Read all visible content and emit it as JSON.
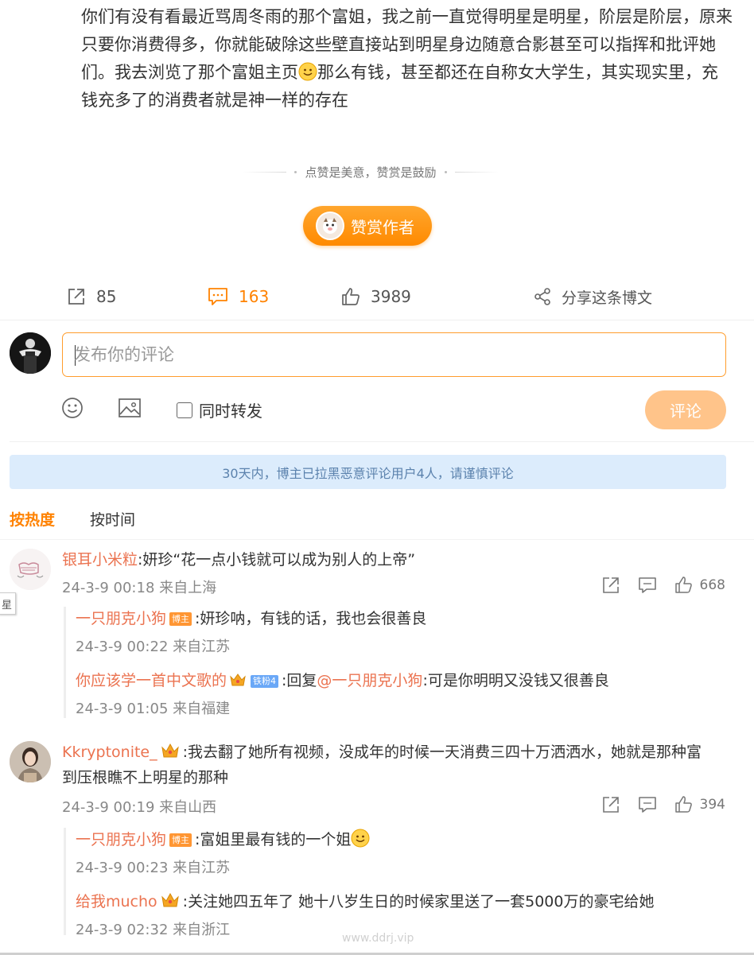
{
  "post": {
    "text": "你们有没有看最近骂周冬雨的那个富姐，我之前一直觉得明星是明星，阶层是阶层，原来只要你消费得多，你就能破除这些壁直接站到明星身边随意合影甚至可以指挥和批评她们。我去浏览了那个富姐主页",
    "text_after_emoji": "那么有钱，甚至都还在自称女大学生，其实现实里，充钱充多了的消费者就是神一样的存在",
    "inline_emoji": "smile-emoji"
  },
  "reward": {
    "divider_text": "点赞是美意，赞赏是鼓励",
    "button_label": "赞赏作者"
  },
  "actions": {
    "repost_count": "85",
    "comment_count": "163",
    "like_count": "3989",
    "share_label": "分享这条博文"
  },
  "composer": {
    "placeholder": "发布你的评论",
    "repost_label": "同时转发",
    "submit_label": "评论"
  },
  "notice": "30天内，博主已拉黑恶意评论用户4人，请谨慎评论",
  "sort": {
    "hot": "按热度",
    "time": "按时间"
  },
  "side_tab": "星",
  "comments": [
    {
      "user": "银耳小米粒",
      "text": ":妍珍“花一点小钱就可以成为别人的上帝”",
      "meta": "24-3-9 00:18 来自上海",
      "likes": "668",
      "replies": [
        {
          "user": "一只朋克小狗",
          "badge": "博主",
          "text": ":妍珍呐，有钱的话，我也会很善良",
          "meta": "24-3-9 00:22 来自江苏"
        },
        {
          "user": "你应该学一首中文歌的",
          "badge": "铁粉4",
          "text_prefix": ":回复",
          "mention": "@一只朋克小狗",
          "text": ":可是你明明又没钱又很善良",
          "meta": "24-3-9 01:05 来自福建"
        }
      ]
    },
    {
      "user": "Kkryptonite_",
      "text_line1": ":我去翻了她所有视频，没成年的时候一天消费三四十万洒洒水，她就是那种富",
      "text_line2": "到压根瞧不上明星的那种",
      "meta": "24-3-9 00:19 来自山西",
      "likes": "394",
      "replies": [
        {
          "user": "一只朋克小狗",
          "badge": "博主",
          "text": ":富姐里最有钱的一个姐",
          "meta": "24-3-9 00:23 来自江苏"
        },
        {
          "user": "给我mucho",
          "text": ":关注她四五年了 她十八岁生日的时候家里送了一套5000万的豪宅给她",
          "meta": "24-3-9 02:32 来自浙江"
        }
      ]
    }
  ],
  "watermark": "www.ddrj.vip",
  "colors": {
    "accent": "#ff8200",
    "username": "#eb7350",
    "notice_bg": "#dcecfc",
    "notice_text": "#5b82ad"
  }
}
